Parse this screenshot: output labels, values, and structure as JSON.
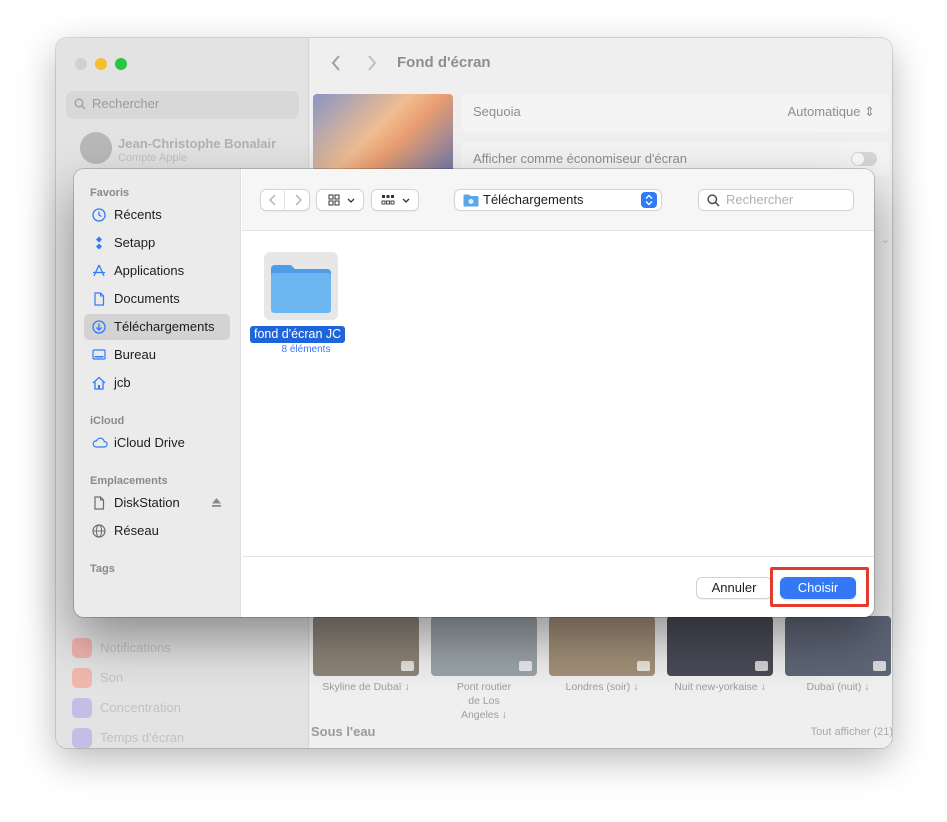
{
  "window": {
    "title": "Fond d'écran",
    "back_icon": "chevron-left-icon",
    "forward_icon": "chevron-right-icon"
  },
  "sidebar": {
    "search_placeholder": "Rechercher",
    "account": {
      "name": "Jean-Christophe Bonalair",
      "subtitle": "Compte Apple"
    },
    "items": [
      {
        "label": "Notifications",
        "color": "#e97b76"
      },
      {
        "label": "Son",
        "color": "#e88a7b"
      },
      {
        "label": "Concentration",
        "color": "#8b7fd3"
      },
      {
        "label": "Temps d'écran",
        "color": "#8b7fd3"
      }
    ]
  },
  "settings": {
    "wallpaper_name": "Sequoia",
    "wallpaper_mode": "Automatique",
    "screensaver_label": "Afficher comme économiseur d'écran",
    "screensaver_enabled": false,
    "section_title": "Sous l'eau",
    "section_link": "Tout afficher (21)",
    "videos": [
      {
        "label": "Skyline de Dubaï ↓",
        "color": "#8d8478"
      },
      {
        "label": "Pont routier de Los Angeles ↓",
        "color": "#9aa3a8"
      },
      {
        "label": "Londres (soir) ↓",
        "color": "#a29078"
      },
      {
        "label": "Nuit new-yorkaise ↓",
        "color": "#4a4a58"
      },
      {
        "label": "Dubaï (nuit) ↓",
        "color": "#5e6676"
      }
    ]
  },
  "dialog": {
    "favorites_header": "Favoris",
    "favorites": [
      {
        "label": "Récents",
        "icon": "clock-icon",
        "selected": false
      },
      {
        "label": "Setapp",
        "icon": "setapp-icon",
        "selected": false
      },
      {
        "label": "Applications",
        "icon": "applications-icon",
        "selected": false
      },
      {
        "label": "Documents",
        "icon": "document-icon",
        "selected": false
      },
      {
        "label": "Téléchargements",
        "icon": "download-icon",
        "selected": true
      },
      {
        "label": "Bureau",
        "icon": "desktop-icon",
        "selected": false
      },
      {
        "label": "jcb",
        "icon": "home-icon",
        "selected": false
      }
    ],
    "icloud_header": "iCloud",
    "icloud": [
      {
        "label": "iCloud Drive",
        "icon": "cloud-icon"
      }
    ],
    "locations_header": "Emplacements",
    "locations": [
      {
        "label": "DiskStation",
        "icon": "document-icon"
      },
      {
        "label": "Réseau",
        "icon": "globe-icon"
      }
    ],
    "tags_header": "Tags",
    "location_popup": "Téléchargements",
    "search_placeholder": "Rechercher",
    "files": [
      {
        "name": "fond d'écran JC",
        "count": "8 éléments"
      }
    ],
    "cancel_label": "Annuler",
    "choose_label": "Choisir",
    "accent": "#3478f6",
    "highlight_color": "#e23a2c"
  }
}
